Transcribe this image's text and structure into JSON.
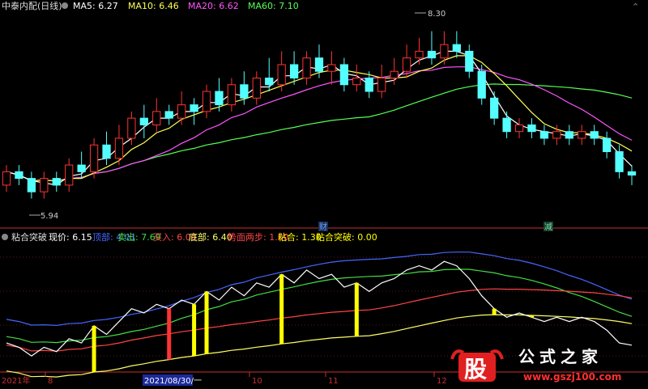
{
  "main_panel": {
    "title": "中泰内配(日线)",
    "ma_legend": [
      {
        "label": "MA5: 6.27",
        "color": "#ffffff"
      },
      {
        "label": "MA10: 6.46",
        "color": "#ffff55"
      },
      {
        "label": "MA20: 6.62",
        "color": "#ff55ff"
      },
      {
        "label": "MA60: 7.10",
        "color": "#55ff55"
      }
    ],
    "high_marker": "8.30",
    "low_marker": "5.94",
    "event_markers": [
      {
        "label": "财",
        "color": "#3a7ad8"
      },
      {
        "label": "减",
        "color": "#3aa46a"
      }
    ]
  },
  "indicator_panel": {
    "title": "粘合突破",
    "legend": [
      {
        "label": "现价: 6.15",
        "color": "#ffffff"
      },
      {
        "label": "顶部: 4.01",
        "color": "#4466ff"
      },
      {
        "label": "卖出: 7.69",
        "color": "#44dd44"
      },
      {
        "label": "买入: 6.00",
        "color": "#ff4444"
      },
      {
        "label": "底部: 6.40",
        "color": "#ffff66"
      },
      {
        "label": "势面两步: 1.00",
        "color": "#ff4444"
      },
      {
        "label": "粘合: 1.30",
        "color": "#ffff00"
      },
      {
        "label": "粘合突破: 0.00",
        "color": "#ffff00"
      }
    ]
  },
  "x_axis": {
    "labels": [
      "2021年",
      "8",
      "2021/08/30/一",
      "10",
      "11",
      "12"
    ]
  },
  "watermark": {
    "logo_char": "股",
    "site_name": "公式之家",
    "url": "www.gszj100.com"
  },
  "chart_data": {
    "type": "candlestick",
    "candles": [
      [
        6.0,
        6.2,
        6.3,
        5.9
      ],
      [
        6.2,
        6.1,
        6.3,
        6.0
      ],
      [
        6.1,
        5.9,
        6.2,
        5.8
      ],
      [
        5.9,
        6.1,
        6.2,
        5.8
      ],
      [
        6.1,
        6.0,
        6.2,
        5.9
      ],
      [
        6.0,
        6.3,
        6.4,
        5.9
      ],
      [
        6.3,
        6.2,
        6.5,
        6.1
      ],
      [
        6.2,
        6.6,
        6.7,
        6.1
      ],
      [
        6.6,
        6.4,
        6.8,
        6.3
      ],
      [
        6.4,
        6.7,
        6.9,
        6.3
      ],
      [
        6.7,
        7.0,
        7.1,
        6.6
      ],
      [
        7.0,
        6.9,
        7.2,
        6.7
      ],
      [
        6.9,
        7.1,
        7.3,
        6.8
      ],
      [
        7.1,
        7.0,
        7.2,
        6.9
      ],
      [
        7.0,
        7.2,
        7.4,
        6.9
      ],
      [
        7.2,
        7.1,
        7.3,
        6.9
      ],
      [
        7.1,
        7.4,
        7.5,
        7.0
      ],
      [
        7.4,
        7.2,
        7.6,
        7.1
      ],
      [
        7.2,
        7.5,
        7.6,
        7.1
      ],
      [
        7.5,
        7.3,
        7.7,
        7.2
      ],
      [
        7.3,
        7.6,
        7.7,
        7.2
      ],
      [
        7.6,
        7.5,
        7.9,
        7.4
      ],
      [
        7.5,
        7.8,
        8.0,
        7.4
      ],
      [
        7.8,
        7.6,
        8.0,
        7.5
      ],
      [
        7.6,
        7.9,
        8.0,
        7.5
      ],
      [
        7.9,
        7.7,
        8.1,
        7.6
      ],
      [
        7.7,
        7.8,
        8.0,
        7.5
      ],
      [
        7.8,
        7.5,
        7.9,
        7.4
      ],
      [
        7.5,
        7.6,
        7.8,
        7.4
      ],
      [
        7.6,
        7.4,
        7.7,
        7.3
      ],
      [
        7.4,
        7.6,
        7.8,
        7.3
      ],
      [
        7.6,
        7.7,
        7.9,
        7.5
      ],
      [
        7.7,
        7.9,
        8.1,
        7.6
      ],
      [
        7.9,
        8.0,
        8.2,
        7.8
      ],
      [
        8.0,
        7.9,
        8.3,
        7.8
      ],
      [
        7.9,
        8.1,
        8.3,
        7.8
      ],
      [
        8.1,
        8.0,
        8.3,
        7.9
      ],
      [
        8.0,
        7.7,
        8.1,
        7.6
      ],
      [
        7.7,
        7.3,
        7.8,
        7.2
      ],
      [
        7.3,
        7.0,
        7.4,
        6.9
      ],
      [
        7.0,
        6.8,
        7.1,
        6.7
      ],
      [
        6.8,
        6.9,
        7.0,
        6.7
      ],
      [
        6.9,
        6.8,
        7.0,
        6.7
      ],
      [
        6.8,
        6.7,
        6.9,
        6.6
      ],
      [
        6.7,
        6.8,
        6.9,
        6.6
      ],
      [
        6.8,
        6.7,
        6.9,
        6.6
      ],
      [
        6.7,
        6.8,
        6.9,
        6.6
      ],
      [
        6.8,
        6.7,
        6.9,
        6.6
      ],
      [
        6.7,
        6.5,
        6.8,
        6.4
      ],
      [
        6.5,
        6.2,
        6.6,
        6.1
      ],
      [
        6.2,
        6.15,
        6.3,
        6.0
      ]
    ],
    "high": 8.3,
    "low": 5.94
  }
}
